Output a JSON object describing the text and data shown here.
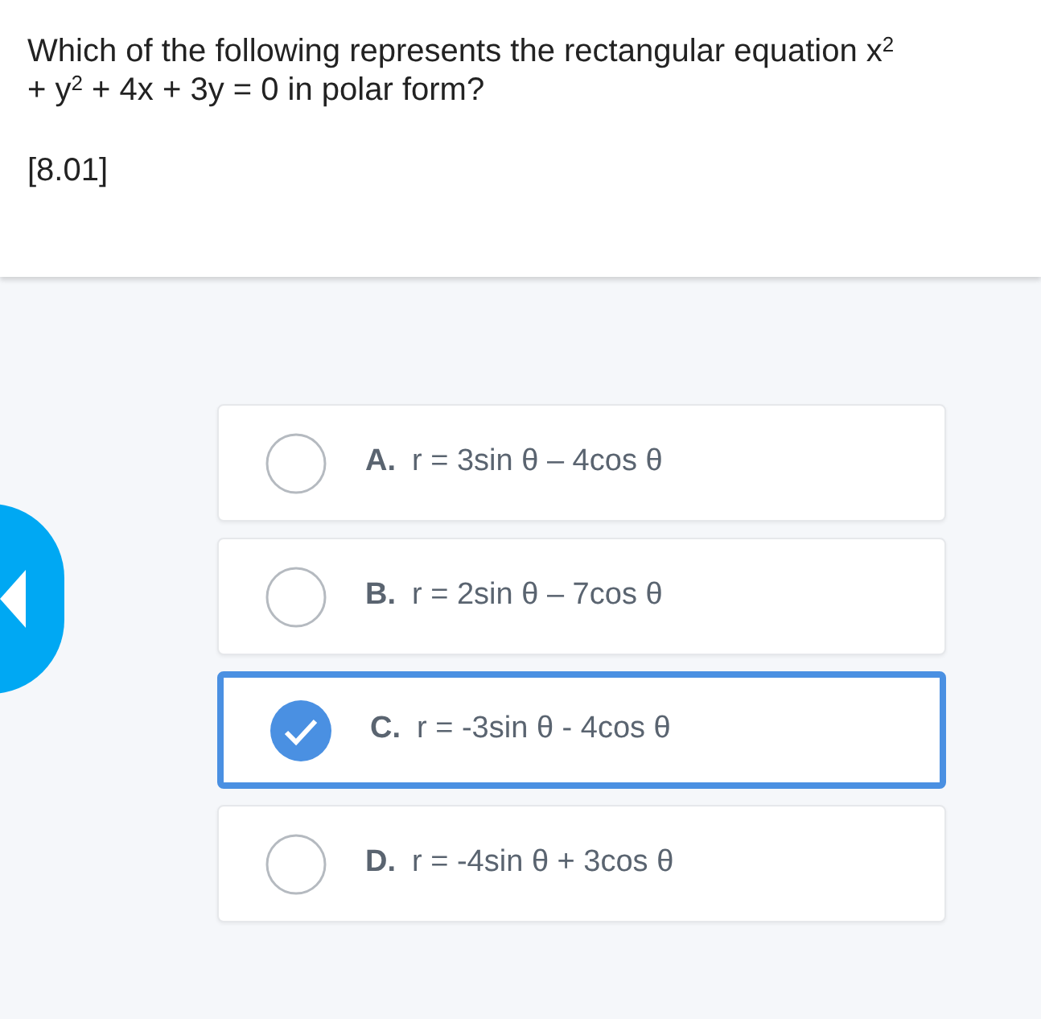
{
  "question": {
    "text": "Which of the following represents the rectangular equation x$^{2}$ + y$^{2}$ + 4x + 3y = 0 in polar form?",
    "code": "[8.01]"
  },
  "options": [
    {
      "letter": "A.",
      "text": "r = 3sin θ – 4cos θ",
      "selected": false
    },
    {
      "letter": "B.",
      "text": "r = 2sin θ – 7cos θ",
      "selected": false
    },
    {
      "letter": "C.",
      "text": "r = -3sin θ - 4cos θ",
      "selected": true
    },
    {
      "letter": "D.",
      "text": "r = -4sin θ + 3cos θ",
      "selected": false
    }
  ]
}
